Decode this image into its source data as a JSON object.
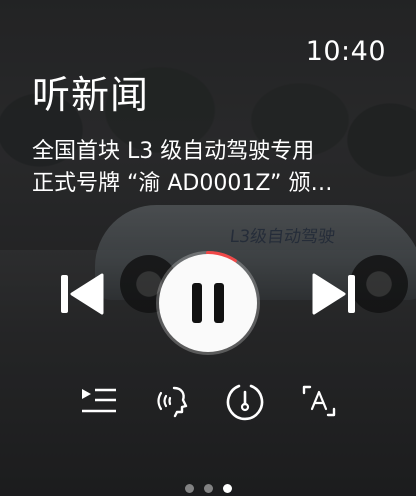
{
  "status": {
    "time": "10:40"
  },
  "header": {
    "title": "听新闻"
  },
  "news": {
    "headline_line1": "全国首块 L3 级自动驾驶专用",
    "headline_line2": "正式号牌 “渝 AD0001Z” 颁…",
    "background_car_text": "L3级自动驾驶"
  },
  "player": {
    "state": "playing",
    "progress_fraction": 0.09,
    "accent_color": "#f04848"
  },
  "page_indicator": {
    "count": 3,
    "active_index": 2
  },
  "icons": {
    "prev": "skip-previous-icon",
    "pause": "pause-icon",
    "next": "skip-next-icon",
    "playlist": "playlist-icon",
    "voice": "voice-broadcast-icon",
    "speed": "speed-gauge-icon",
    "text_size": "text-size-icon"
  }
}
